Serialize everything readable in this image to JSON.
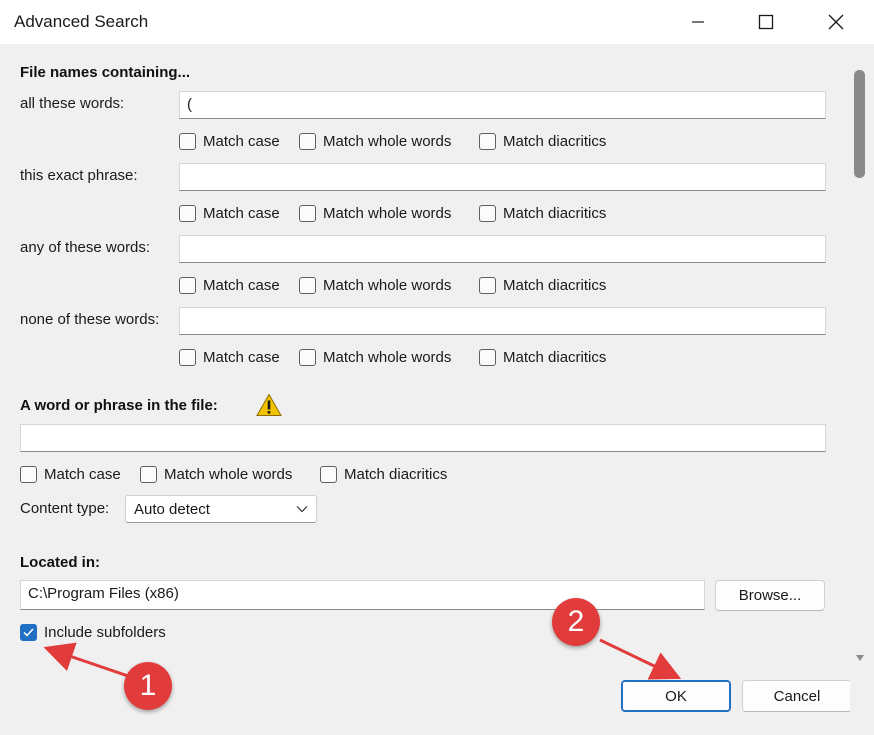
{
  "window": {
    "title": "Advanced Search"
  },
  "filenames": {
    "heading": "File names containing...",
    "rows": [
      {
        "label": "all these words:",
        "value": "("
      },
      {
        "label": "this exact phrase:",
        "value": ""
      },
      {
        "label": "any of these words:",
        "value": ""
      },
      {
        "label": "none of these words:",
        "value": ""
      }
    ],
    "options": {
      "match_case": "Match case",
      "match_whole": "Match whole words",
      "match_diacritics": "Match diacritics"
    }
  },
  "content": {
    "heading": "A word or phrase in the file:",
    "value": "",
    "match_case": "Match case",
    "match_whole": "Match whole words",
    "match_diacritics": "Match diacritics",
    "type_label": "Content type:",
    "type_value": "Auto detect"
  },
  "location": {
    "heading": "Located in:",
    "path": "C:\\Program Files (x86)",
    "browse": "Browse...",
    "include_subfolders": "Include subfolders",
    "include_subfolders_checked": true
  },
  "buttons": {
    "ok": "OK",
    "cancel": "Cancel"
  },
  "annotations": {
    "one": "1",
    "two": "2"
  },
  "colors": {
    "accent": "#1f6fc5",
    "annotation": "#e23b3b",
    "warning": "#f2c200"
  }
}
